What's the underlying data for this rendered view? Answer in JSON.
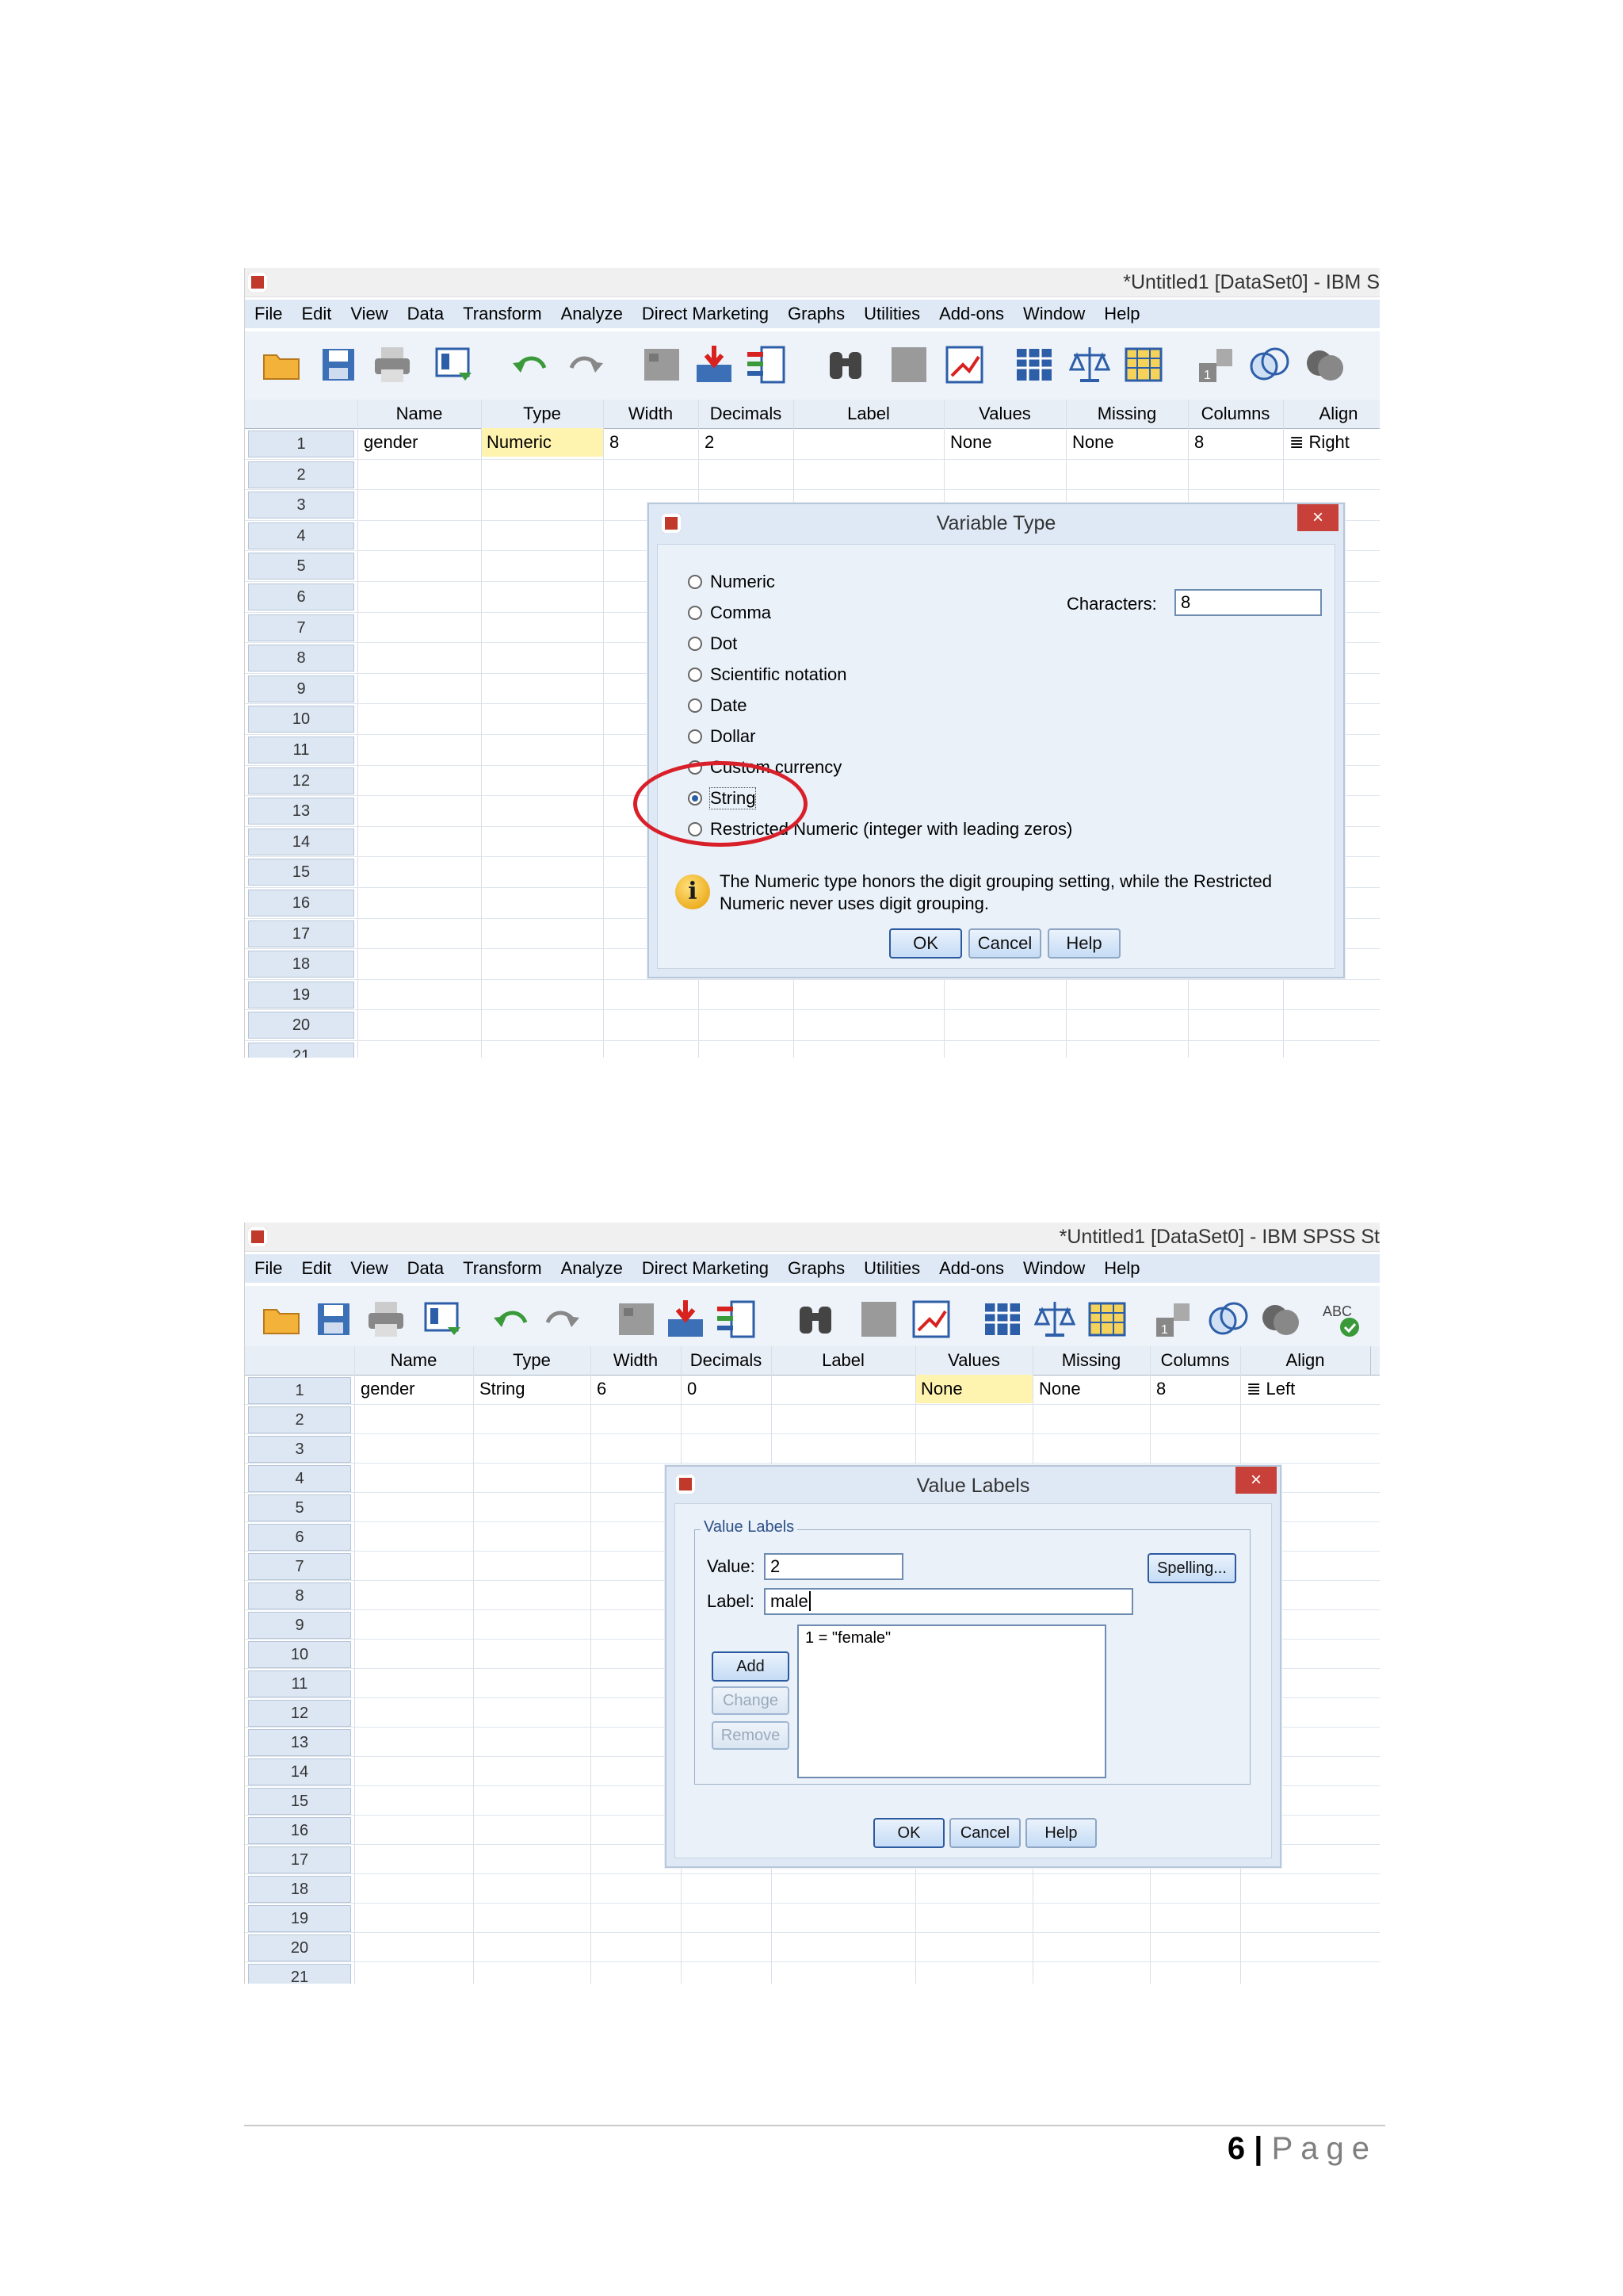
{
  "screenshot1": {
    "window_title": "*Untitled1 [DataSet0] - IBM S",
    "menu": [
      "File",
      "Edit",
      "View",
      "Data",
      "Transform",
      "Analyze",
      "Direct Marketing",
      "Graphs",
      "Utilities",
      "Add-ons",
      "Window",
      "Help"
    ],
    "columns": [
      "Name",
      "Type",
      "Width",
      "Decimals",
      "Label",
      "Values",
      "Missing",
      "Columns",
      "Align"
    ],
    "row1": {
      "name": "gender",
      "type": "Numeric",
      "width": "8",
      "decimals": "2",
      "label": "",
      "values": "None",
      "missing": "None",
      "columns": "8",
      "align": "Right"
    },
    "row_numbers": [
      "1",
      "2",
      "3",
      "4",
      "5",
      "6",
      "7",
      "8",
      "9",
      "10",
      "11",
      "12",
      "13",
      "14",
      "15",
      "16",
      "17",
      "18",
      "19",
      "20",
      "21"
    ],
    "dialog": {
      "title": "Variable Type",
      "close": "×",
      "options": [
        "Numeric",
        "Comma",
        "Dot",
        "Scientific notation",
        "Date",
        "Dollar",
        "Custom currency",
        "String",
        "Restricted Numeric (integer with leading zeros)"
      ],
      "selected": "String",
      "characters_label": "Characters:",
      "characters_value": "8",
      "info_line1": "The Numeric type honors the digit grouping setting, while the Restricted",
      "info_line2": "Numeric never uses digit grouping.",
      "ok": "OK",
      "cancel": "Cancel",
      "help": "Help"
    }
  },
  "screenshot2": {
    "window_title": "*Untitled1 [DataSet0] - IBM SPSS St",
    "menu": [
      "File",
      "Edit",
      "View",
      "Data",
      "Transform",
      "Analyze",
      "Direct Marketing",
      "Graphs",
      "Utilities",
      "Add-ons",
      "Window",
      "Help"
    ],
    "columns": [
      "Name",
      "Type",
      "Width",
      "Decimals",
      "Label",
      "Values",
      "Missing",
      "Columns",
      "Align"
    ],
    "row1": {
      "name": "gender",
      "type": "String",
      "width": "6",
      "decimals": "0",
      "label": "",
      "values": "None",
      "missing": "None",
      "columns": "8",
      "align": "Left"
    },
    "row_numbers": [
      "1",
      "2",
      "3",
      "4",
      "5",
      "6",
      "7",
      "8",
      "9",
      "10",
      "11",
      "12",
      "13",
      "14",
      "15",
      "16",
      "17",
      "18",
      "19",
      "20",
      "21"
    ],
    "dialog": {
      "title": "Value Labels",
      "close": "×",
      "group_label": "Value Labels",
      "value_label": "Value:",
      "value": "2",
      "label_label": "Label:",
      "label": "male",
      "spelling": "Spelling...",
      "list_items": [
        "1 = \"female\""
      ],
      "add": "Add",
      "change": "Change",
      "remove": "Remove",
      "ok": "OK",
      "cancel": "Cancel",
      "help": "Help"
    }
  },
  "footer": {
    "page_number": "6",
    "separator": "|",
    "page_word": "Page"
  }
}
